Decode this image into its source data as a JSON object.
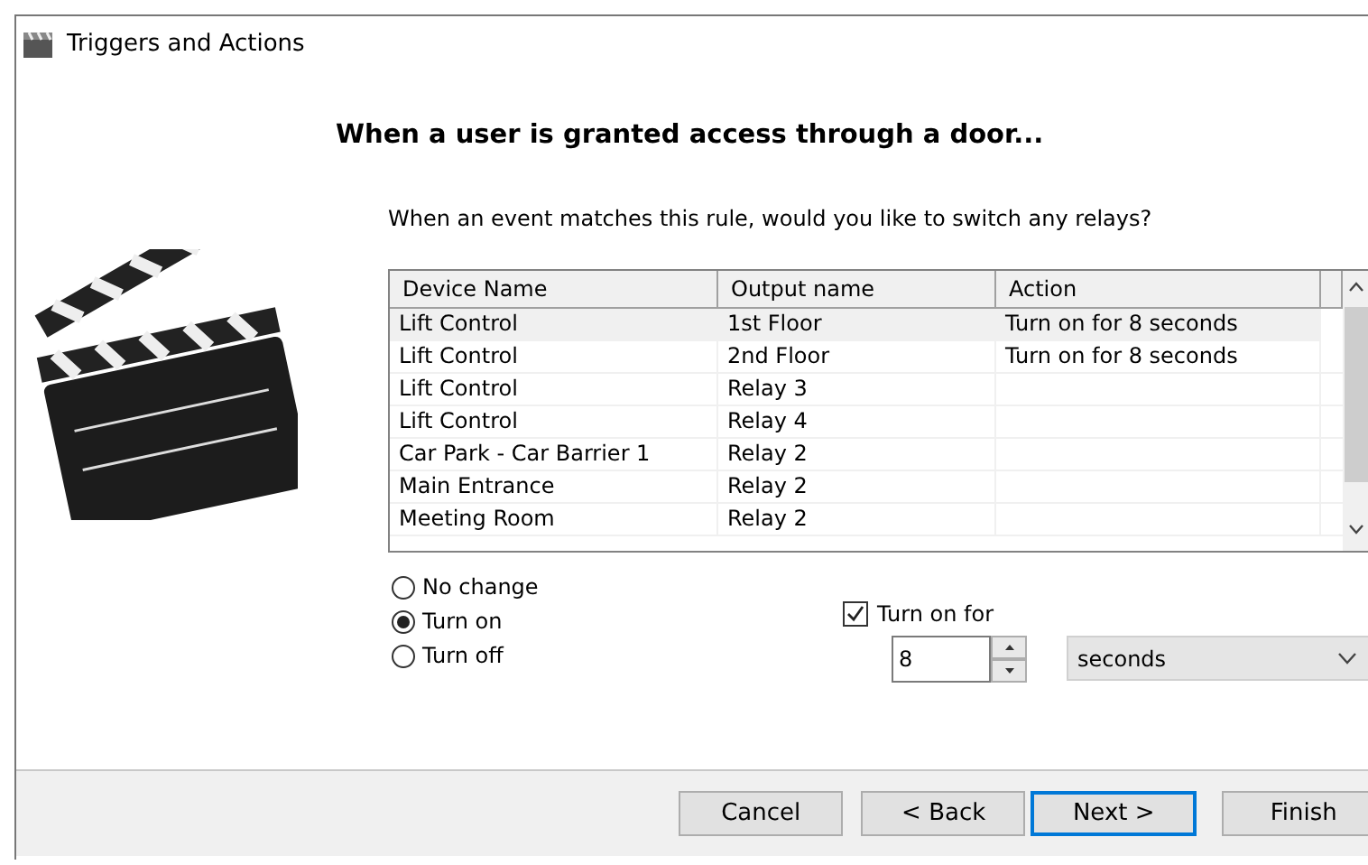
{
  "window": {
    "title": "Triggers and Actions"
  },
  "heading": "When a user is granted access through a door...",
  "prompt": "When an event matches this rule, would you like to switch any relays?",
  "table": {
    "columns": [
      "Device Name",
      "Output name",
      "Action"
    ],
    "rows": [
      {
        "cells": [
          "Lift Control",
          "1st Floor",
          "Turn on for 8 seconds"
        ],
        "selected": true
      },
      {
        "cells": [
          "Lift Control",
          "2nd Floor",
          "Turn on for 8 seconds"
        ],
        "selected": false
      },
      {
        "cells": [
          "Lift Control",
          "Relay 3",
          ""
        ],
        "selected": false
      },
      {
        "cells": [
          "Lift Control",
          "Relay 4",
          ""
        ],
        "selected": false
      },
      {
        "cells": [
          "Car Park - Car Barrier 1",
          "Relay 2",
          ""
        ],
        "selected": false
      },
      {
        "cells": [
          "Main Entrance",
          "Relay 2",
          ""
        ],
        "selected": false
      },
      {
        "cells": [
          "Meeting Room",
          "Relay 2",
          ""
        ],
        "selected": false
      }
    ]
  },
  "options": [
    {
      "label": "No change",
      "selected": false
    },
    {
      "label": "Turn on",
      "selected": true
    },
    {
      "label": "Turn off",
      "selected": false
    }
  ],
  "duration": {
    "label": "Turn on for",
    "checked": true,
    "value": "8",
    "unit": "seconds"
  },
  "buttons": [
    {
      "label": "Cancel",
      "default": false
    },
    {
      "label": "< Back",
      "default": false
    },
    {
      "label": "Next >",
      "default": true
    },
    {
      "label": "Finish",
      "default": false
    }
  ]
}
